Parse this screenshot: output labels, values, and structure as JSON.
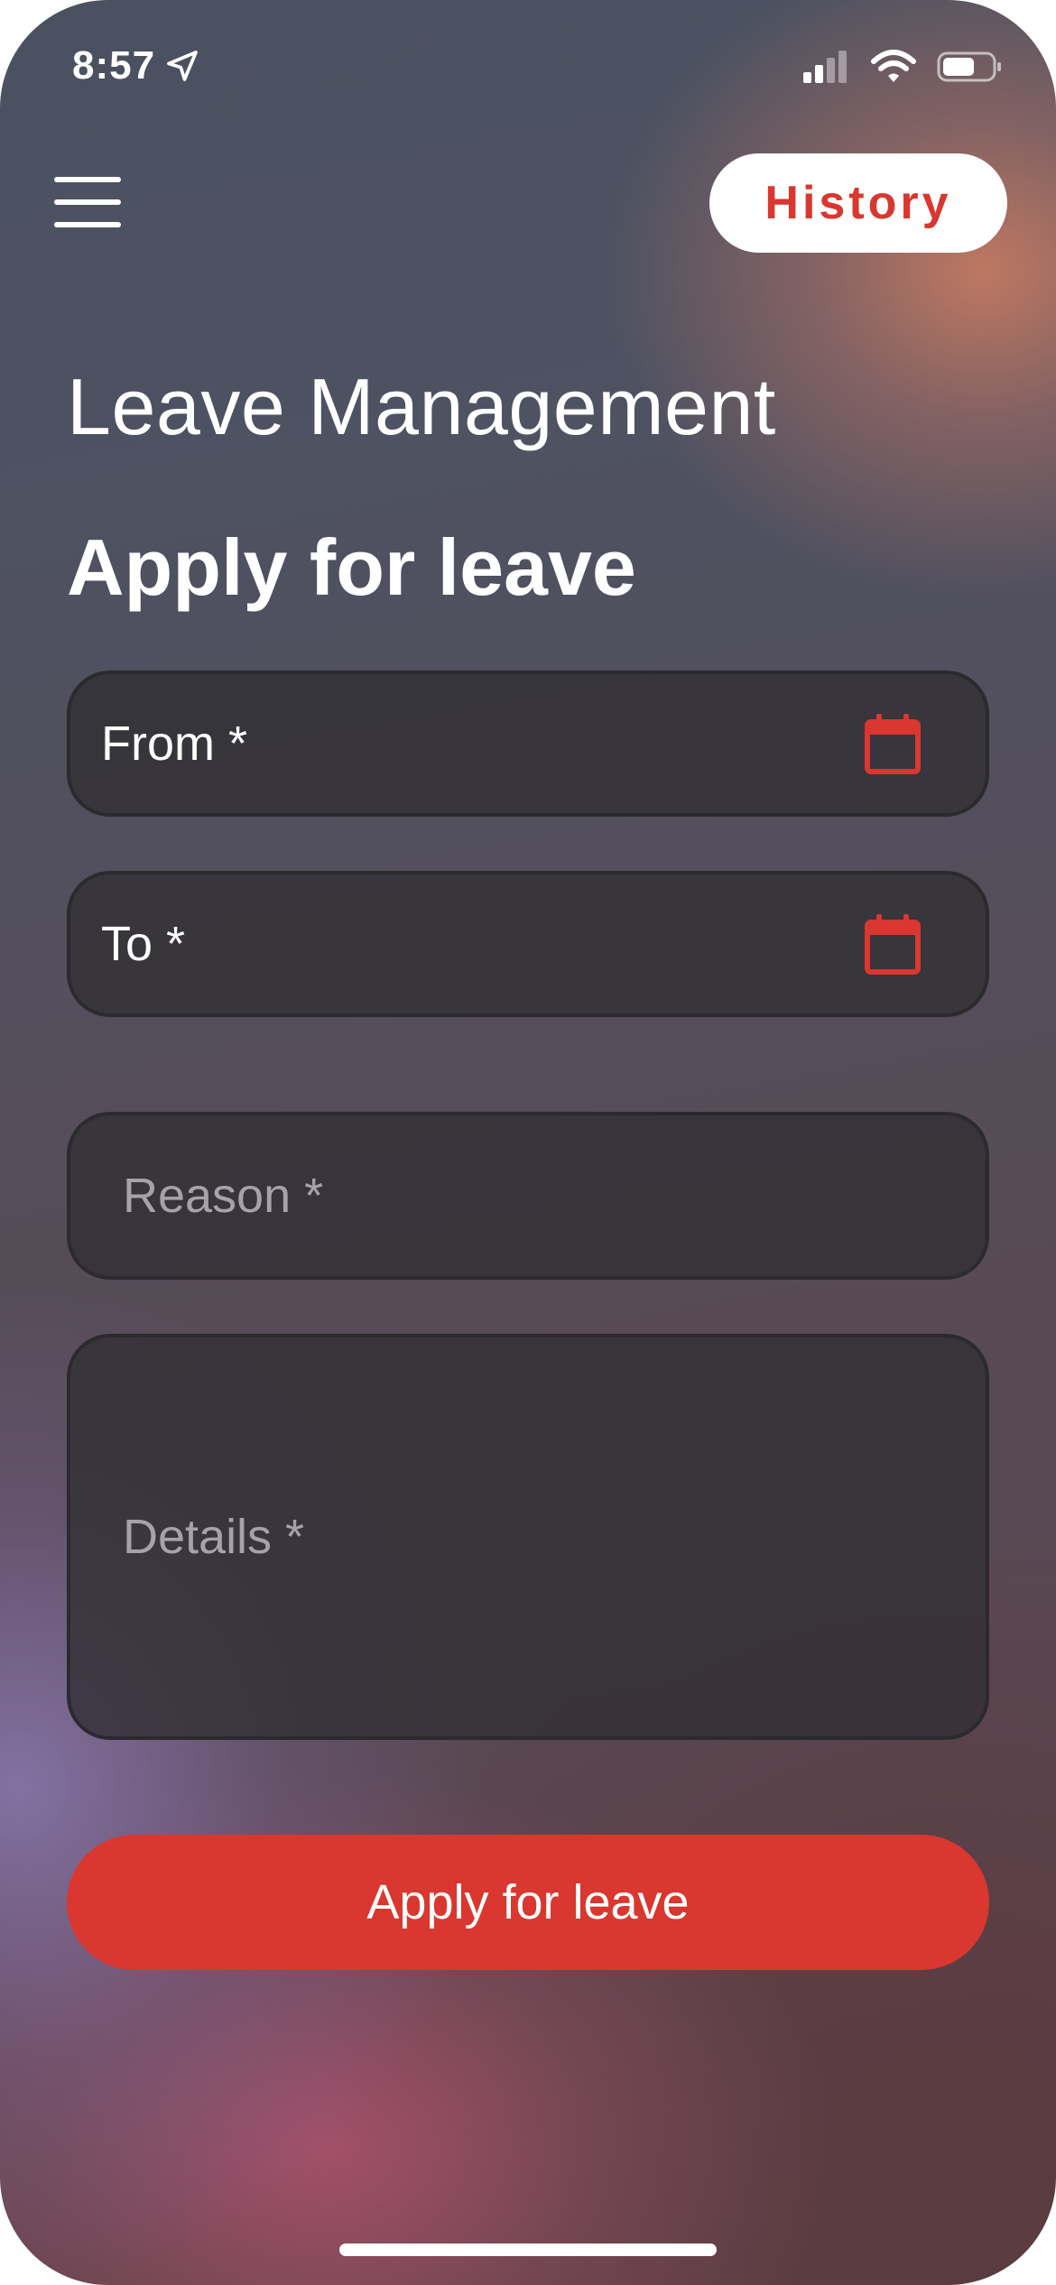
{
  "status_bar": {
    "time": "8:57",
    "icons": [
      "location-arrow-icon",
      "cellular-signal-icon",
      "wifi-icon",
      "battery-icon"
    ]
  },
  "header": {
    "menu_icon": "hamburger-menu-icon",
    "history_label": "History"
  },
  "page": {
    "title": "Leave Management",
    "section_title": "Apply for leave"
  },
  "form": {
    "from_label": "From *",
    "to_label": "To *",
    "reason_placeholder": "Reason *",
    "details_placeholder": "Details *",
    "calendar_icon": "calendar-icon",
    "submit_label": "Apply for leave"
  },
  "colors": {
    "accent": "#d9372f",
    "field_background": "#353337",
    "text": "#ffffff",
    "placeholder": "#a6a3a8"
  }
}
